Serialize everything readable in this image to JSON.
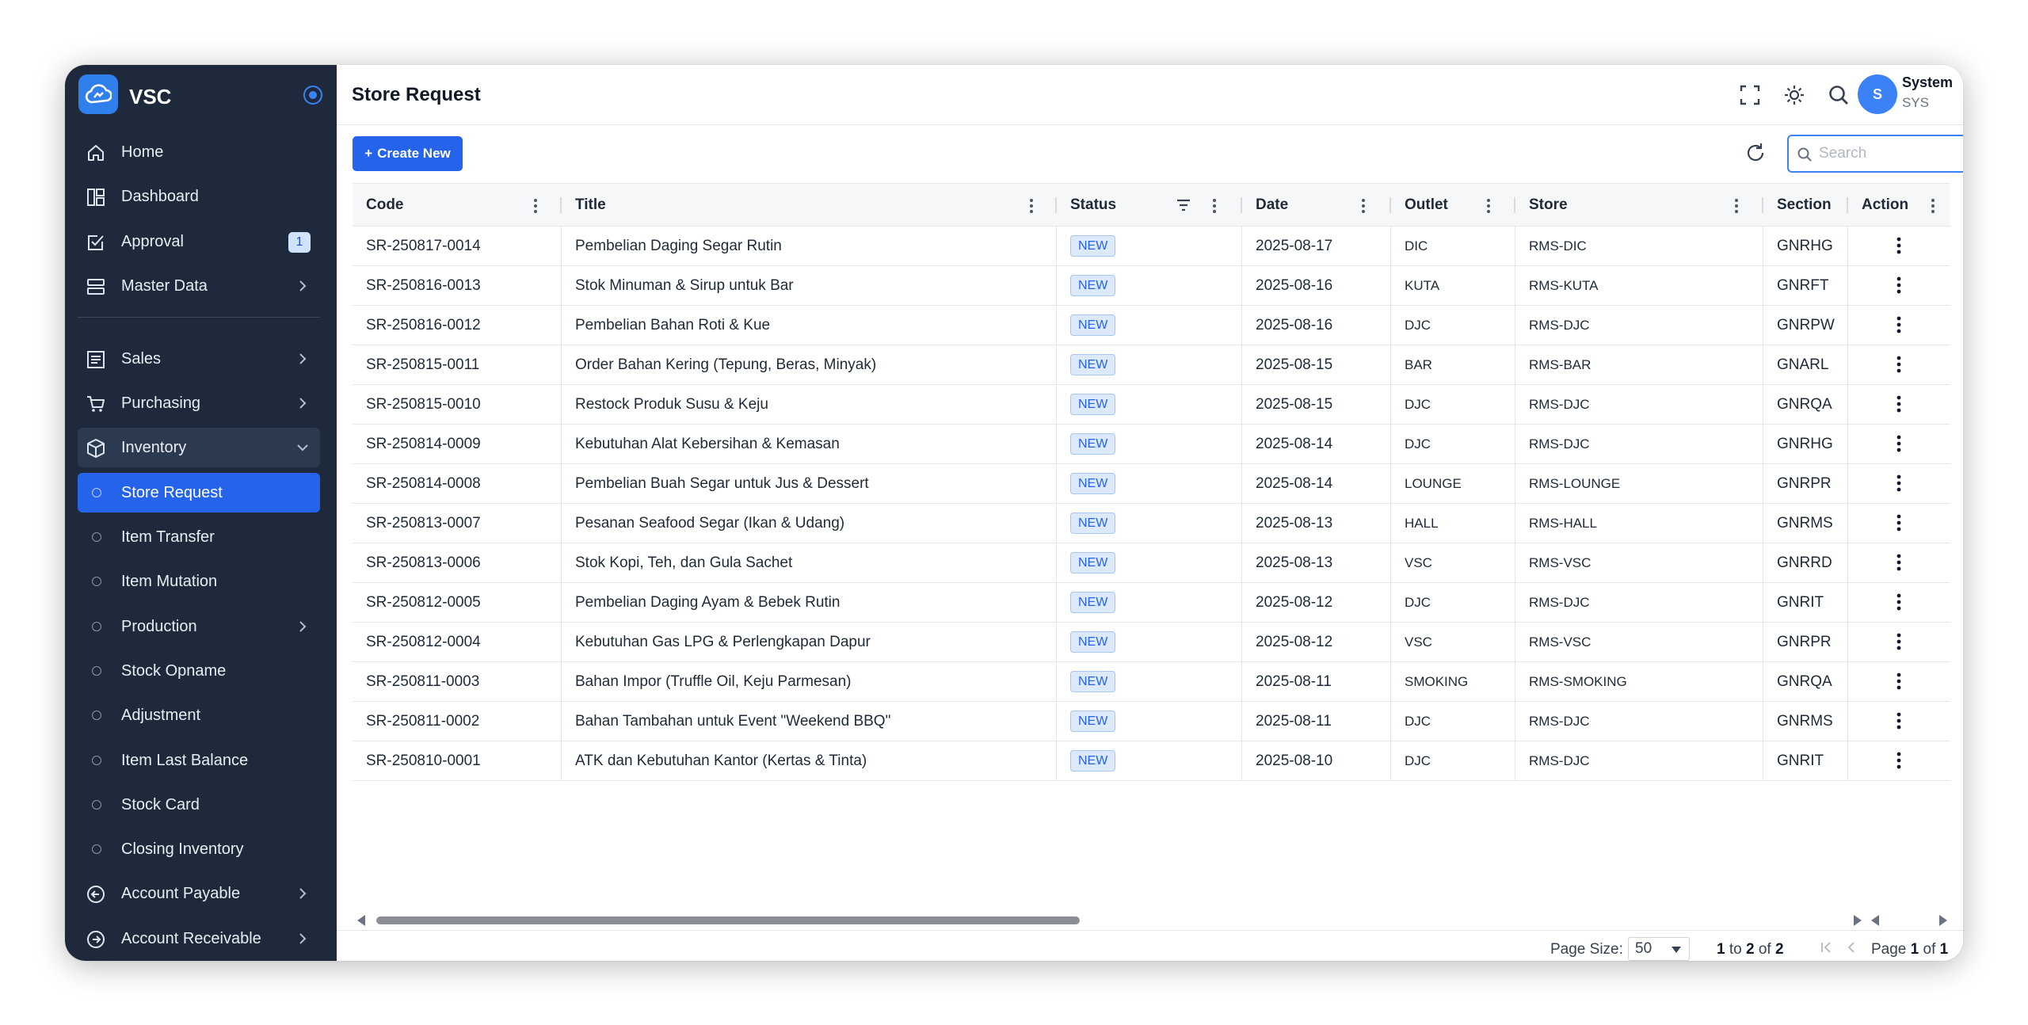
{
  "app": {
    "name": "VSC",
    "page_title": "Store Request"
  },
  "colors": {
    "sidebar_bg": "#1e2a3b",
    "accent": "#2563eb",
    "status_bg": "#dce9fb"
  },
  "sidebar": {
    "items": [
      {
        "label": "Home",
        "icon": "home-icon"
      },
      {
        "label": "Dashboard",
        "icon": "dashboard-icon"
      },
      {
        "label": "Approval",
        "icon": "approval-icon",
        "badge": "1"
      },
      {
        "label": "Master Data",
        "icon": "database-icon"
      }
    ],
    "groups": [
      {
        "label": "Sales",
        "icon": "sales-icon"
      },
      {
        "label": "Purchasing",
        "icon": "cart-icon"
      },
      {
        "label": "Inventory",
        "icon": "box-icon"
      }
    ],
    "inventory_sub": [
      {
        "label": "Store Request"
      },
      {
        "label": "Item Transfer"
      },
      {
        "label": "Item Mutation"
      },
      {
        "label": "Production"
      },
      {
        "label": "Stock Opname"
      },
      {
        "label": "Adjustment"
      },
      {
        "label": "Item Last Balance"
      },
      {
        "label": "Stock Card"
      },
      {
        "label": "Closing Inventory"
      }
    ],
    "bottom": [
      {
        "label": "Account Payable",
        "icon": "arrow-left-circle-icon"
      },
      {
        "label": "Account Receivable",
        "icon": "arrow-right-circle-icon"
      }
    ]
  },
  "user": {
    "initial": "S",
    "name": "System",
    "code": "SYS"
  },
  "toolbar": {
    "create_label": "Create New",
    "search_placeholder": "Search"
  },
  "table": {
    "columns": [
      "Code",
      "Title",
      "Status",
      "Date",
      "Outlet",
      "Store",
      "Section",
      "Action"
    ],
    "rows": [
      {
        "code": "SR-250817-0014",
        "title": "Pembelian Daging Segar Rutin",
        "status": "NEW",
        "date": "2025-08-17",
        "outlet": "DIC",
        "store": "RMS-DIC",
        "section": "GNRHG"
      },
      {
        "code": "SR-250816-0013",
        "title": "Stok Minuman & Sirup untuk Bar",
        "status": "NEW",
        "date": "2025-08-16",
        "outlet": "KUTA",
        "store": "RMS-KUTA",
        "section": "GNRFT"
      },
      {
        "code": "SR-250816-0012",
        "title": "Pembelian Bahan Roti & Kue",
        "status": "NEW",
        "date": "2025-08-16",
        "outlet": "DJC",
        "store": "RMS-DJC",
        "section": "GNRPW"
      },
      {
        "code": "SR-250815-0011",
        "title": "Order Bahan Kering (Tepung, Beras, Minyak)",
        "status": "NEW",
        "date": "2025-08-15",
        "outlet": "BAR",
        "store": "RMS-BAR",
        "section": "GNARL"
      },
      {
        "code": "SR-250815-0010",
        "title": "Restock Produk Susu & Keju",
        "status": "NEW",
        "date": "2025-08-15",
        "outlet": "DJC",
        "store": "RMS-DJC",
        "section": "GNRQA"
      },
      {
        "code": "SR-250814-0009",
        "title": "Kebutuhan Alat Kebersihan & Kemasan",
        "status": "NEW",
        "date": "2025-08-14",
        "outlet": "DJC",
        "store": "RMS-DJC",
        "section": "GNRHG"
      },
      {
        "code": "SR-250814-0008",
        "title": "Pembelian Buah Segar untuk Jus & Dessert",
        "status": "NEW",
        "date": "2025-08-14",
        "outlet": "LOUNGE",
        "store": "RMS-LOUNGE",
        "section": "GNRPR"
      },
      {
        "code": "SR-250813-0007",
        "title": "Pesanan Seafood Segar (Ikan & Udang)",
        "status": "NEW",
        "date": "2025-08-13",
        "outlet": "HALL",
        "store": "RMS-HALL",
        "section": "GNRMS"
      },
      {
        "code": "SR-250813-0006",
        "title": "Stok Kopi, Teh, dan Gula Sachet",
        "status": "NEW",
        "date": "2025-08-13",
        "outlet": "VSC",
        "store": "RMS-VSC",
        "section": "GNRRD"
      },
      {
        "code": "SR-250812-0005",
        "title": "Pembelian Daging Ayam & Bebek Rutin",
        "status": "NEW",
        "date": "2025-08-12",
        "outlet": "DJC",
        "store": "RMS-DJC",
        "section": "GNRIT"
      },
      {
        "code": "SR-250812-0004",
        "title": "Kebutuhan Gas LPG & Perlengkapan Dapur",
        "status": "NEW",
        "date": "2025-08-12",
        "outlet": "VSC",
        "store": "RMS-VSC",
        "section": "GNRPR"
      },
      {
        "code": "SR-250811-0003",
        "title": "Bahan Impor (Truffle Oil, Keju Parmesan)",
        "status": "NEW",
        "date": "2025-08-11",
        "outlet": "SMOKING",
        "store": "RMS-SMOKING",
        "section": "GNRQA"
      },
      {
        "code": "SR-250811-0002",
        "title": "Bahan Tambahan untuk Event \"Weekend BBQ\"",
        "status": "NEW",
        "date": "2025-08-11",
        "outlet": "DJC",
        "store": "RMS-DJC",
        "section": "GNRMS"
      },
      {
        "code": "SR-250810-0001",
        "title": "ATK dan Kebutuhan Kantor (Kertas & Tinta)",
        "status": "NEW",
        "date": "2025-08-10",
        "outlet": "DJC",
        "store": "RMS-DJC",
        "section": "GNRIT"
      }
    ]
  },
  "pagination": {
    "page_size_label": "Page Size:",
    "page_size": "50",
    "range_from": "1",
    "range_to_word": "to",
    "range_to": "2",
    "of_word": "of",
    "total": "2",
    "page_word": "Page",
    "page": "1",
    "pages": "1"
  }
}
